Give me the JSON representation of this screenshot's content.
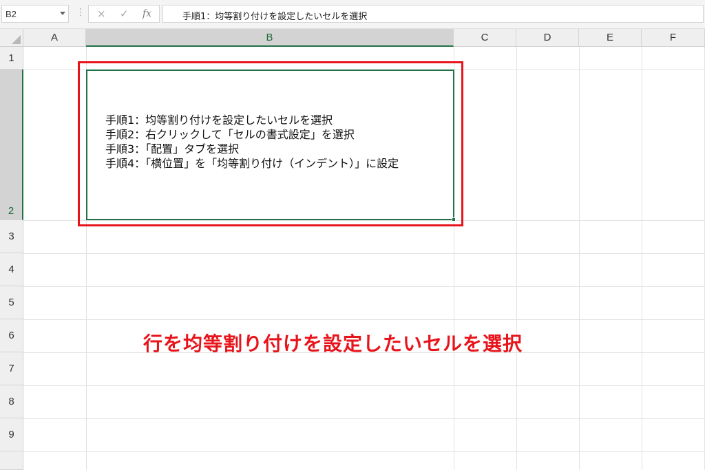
{
  "formula_bar": {
    "name_box": "B2",
    "separator": "⋮",
    "cancel_icon": "×",
    "enter_icon": "✓",
    "fx_icon": "fx",
    "formula": "手順1：均等割り付けを設定したいセルを選択"
  },
  "columns": [
    "A",
    "B",
    "C",
    "D",
    "E",
    "F"
  ],
  "rows": [
    "1",
    "2",
    "3",
    "4",
    "5",
    "6",
    "7",
    "8",
    "9"
  ],
  "cell_b2": {
    "lines": [
      "手順1：均等割り付けを設定したいセルを選択",
      "手順2：右クリックして「セルの書式設定」を選択",
      "手順3：「配置」タブを選択",
      "手順4：「横位置」を「均等割り付け（インデント）」に設定"
    ]
  },
  "annotation": "行を均等割り付けを設定したいセルを選択",
  "colors": {
    "selection_green": "#217346",
    "highlight_red": "#e8141b"
  }
}
